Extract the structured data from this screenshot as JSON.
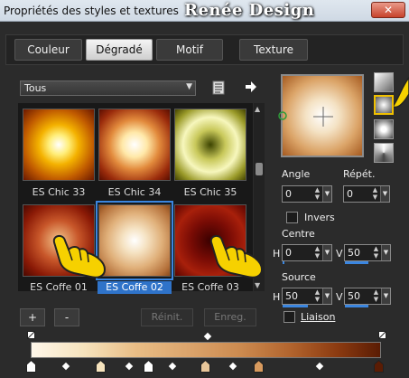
{
  "window": {
    "title": "Propriétés des styles et textures",
    "logo": "Renée Design",
    "close_label": "✕"
  },
  "tabs": [
    {
      "label": "Couleur",
      "active": false
    },
    {
      "label": "Dégradé",
      "active": true
    },
    {
      "label": "Motif",
      "active": false
    },
    {
      "label": "Texture",
      "active": false
    }
  ],
  "category": {
    "value": "Tous"
  },
  "gallery": {
    "items": [
      {
        "label": "ES Chic 33",
        "selected": false
      },
      {
        "label": "ES Chic 34",
        "selected": false
      },
      {
        "label": "ES Chic 35",
        "selected": false
      },
      {
        "label": "ES Coffe 01",
        "selected": false
      },
      {
        "label": "ES Coffe 02",
        "selected": true
      },
      {
        "label": "ES Coffe 03",
        "selected": false
      }
    ]
  },
  "controls": {
    "angle_label": "Angle",
    "angle_value": "0",
    "repeat_label": "Répét.",
    "repeat_value": "0",
    "invert_label": "Invers",
    "centre_label": "Centre",
    "centre_h_label": "H",
    "centre_h_value": "0",
    "centre_v_label": "V",
    "centre_v_value": "50",
    "source_label": "Source",
    "source_h_label": "H",
    "source_h_value": "50",
    "source_v_label": "V",
    "source_v_value": "50",
    "link_label": "Liaison"
  },
  "buttons": {
    "add": "+",
    "remove": "-",
    "reset": "Réinit.",
    "save": "Enreg."
  },
  "colors": {
    "accent": "#3b86e0",
    "pointer": "#f4c400"
  },
  "icons": [
    "list-icon",
    "arrow-right-icon",
    "pointing-hand-icon",
    "close-icon"
  ]
}
